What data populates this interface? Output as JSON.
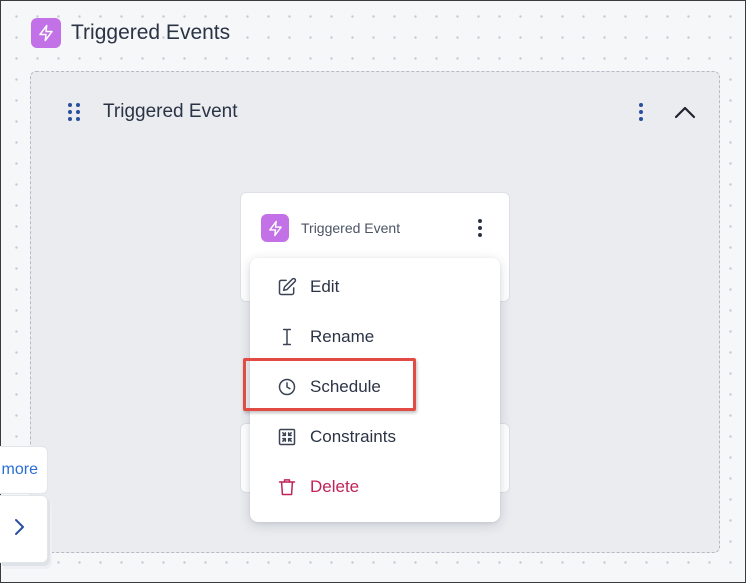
{
  "header": {
    "icon": "lightning-bolt-icon",
    "title": "Triggered Events"
  },
  "container": {
    "drag_icon": "drag-handle-icon",
    "title": "Triggered Event",
    "menu_icon": "kebab-menu-icon",
    "collapse_icon": "chevron-up-icon"
  },
  "node": {
    "icon": "lightning-bolt-icon",
    "title": "Triggered Event",
    "menu_icon": "kebab-menu-icon"
  },
  "menu": {
    "items": [
      {
        "label": "Edit",
        "icon": "edit-icon"
      },
      {
        "label": "Rename",
        "icon": "text-cursor-icon"
      },
      {
        "label": "Schedule",
        "icon": "clock-icon",
        "highlighted": true
      },
      {
        "label": "Constraints",
        "icon": "constraints-icon"
      },
      {
        "label": "Delete",
        "icon": "trash-icon",
        "danger": true
      }
    ]
  },
  "side": {
    "more_label": "more",
    "next_icon": "chevron-right-icon"
  },
  "colors": {
    "accent_purple": "#c271e6",
    "danger": "#c0245a",
    "highlight": "#e24a44",
    "link": "#2a6fd6"
  }
}
